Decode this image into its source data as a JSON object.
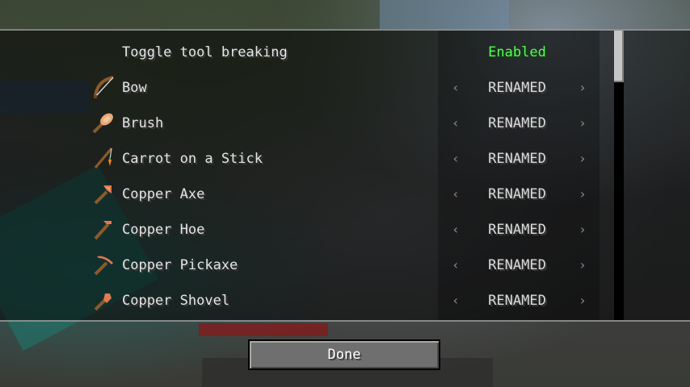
{
  "colors": {
    "enabled": "#55ff55",
    "label": "#e6e6e6",
    "value": "#dcdcdc",
    "arrow": "#8c8c8c"
  },
  "icons": {
    "prev": "‹",
    "next": "›"
  },
  "toggle": {
    "label": "Toggle tool breaking",
    "value": "Enabled"
  },
  "items": [
    {
      "label": "Bow",
      "value": "RENAMED",
      "icon": "bow-icon"
    },
    {
      "label": "Brush",
      "value": "RENAMED",
      "icon": "brush-icon"
    },
    {
      "label": "Carrot on a Stick",
      "value": "RENAMED",
      "icon": "carrot-on-a-stick-icon"
    },
    {
      "label": "Copper Axe",
      "value": "RENAMED",
      "icon": "copper-axe-icon"
    },
    {
      "label": "Copper Hoe",
      "value": "RENAMED",
      "icon": "copper-hoe-icon"
    },
    {
      "label": "Copper Pickaxe",
      "value": "RENAMED",
      "icon": "copper-pickaxe-icon"
    },
    {
      "label": "Copper Shovel",
      "value": "RENAMED",
      "icon": "copper-shovel-icon"
    }
  ],
  "footer": {
    "done_label": "Done"
  }
}
